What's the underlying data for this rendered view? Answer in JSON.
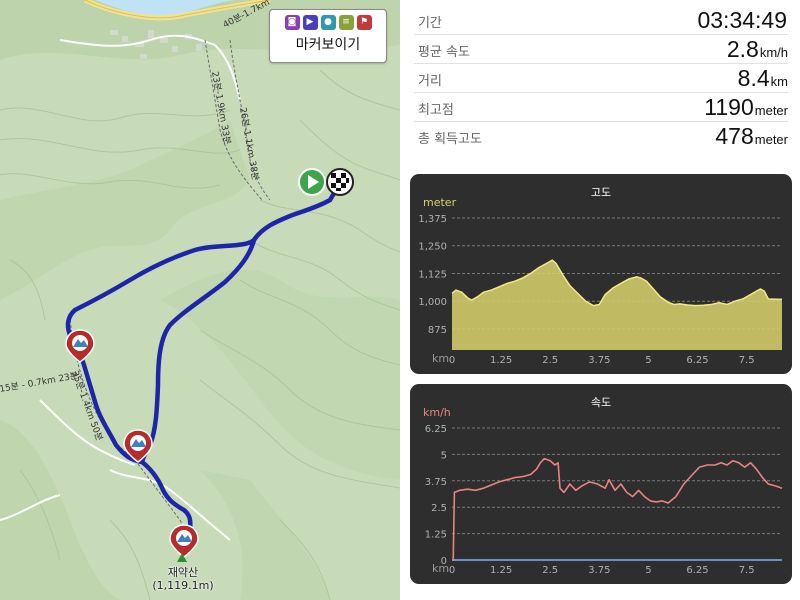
{
  "map": {
    "marker_toggle_label": "마커보이기",
    "marker_toggle_icons": [
      "camera-icon",
      "video-icon",
      "pin-icon",
      "note-icon",
      "flag-icon"
    ],
    "peak_name": "재약산",
    "peak_elevation": "(1,119.1m)",
    "trail_labels": [
      "40분-1.7km",
      "23분-1.9km 33분",
      "26분-1.1km 38분",
      "35분-1.4km 50분",
      "15분 - 0.7km 23분"
    ],
    "start_marker": "start-icon",
    "finish_marker": "finish-flag-icon",
    "route_color": "#1e25a8"
  },
  "stats": [
    {
      "label": "기간",
      "value": "03:34:49",
      "unit": ""
    },
    {
      "label": "평균 속도",
      "value": "2.8",
      "unit": "km/h"
    },
    {
      "label": "거리",
      "value": "8.4",
      "unit": "km"
    },
    {
      "label": "최고점",
      "value": "1190",
      "unit": "meter"
    },
    {
      "label": "총 획득고도",
      "value": "478",
      "unit": "meter"
    }
  ],
  "chart_data": [
    {
      "type": "area",
      "title": "고도",
      "ylabel": "meter",
      "xlabel": "km",
      "x_ticks": [
        0,
        1.25,
        2.5,
        3.75,
        5,
        6.25,
        7.5
      ],
      "y_ticks": [
        875,
        1000,
        1125,
        1250,
        1375
      ],
      "y_tick_labels": [
        "875",
        "1,000",
        "1,125",
        "1,250",
        "1,375"
      ],
      "ylim": [
        780,
        1375
      ],
      "xlim": [
        0,
        8.4
      ],
      "color": "#d9d36c",
      "x": [
        0,
        0.1,
        0.25,
        0.4,
        0.5,
        0.65,
        0.8,
        1.0,
        1.2,
        1.4,
        1.6,
        1.8,
        2.0,
        2.2,
        2.4,
        2.55,
        2.65,
        2.75,
        2.85,
        3.0,
        3.2,
        3.4,
        3.6,
        3.75,
        3.9,
        4.1,
        4.3,
        4.5,
        4.7,
        4.8,
        4.95,
        5.1,
        5.3,
        5.5,
        5.65,
        5.8,
        6.0,
        6.2,
        6.4,
        6.6,
        6.8,
        7.0,
        7.2,
        7.4,
        7.55,
        7.7,
        7.85,
        7.95,
        8.05,
        8.4
      ],
      "values": [
        1035,
        1050,
        1040,
        1015,
        1005,
        1020,
        1040,
        1050,
        1065,
        1080,
        1090,
        1105,
        1125,
        1150,
        1170,
        1185,
        1170,
        1140,
        1110,
        1070,
        1035,
        1000,
        980,
        985,
        1030,
        1060,
        1080,
        1100,
        1110,
        1105,
        1090,
        1060,
        1020,
        995,
        985,
        988,
        983,
        980,
        982,
        985,
        993,
        985,
        1000,
        1010,
        1025,
        1040,
        1055,
        1045,
        1010,
        1008
      ]
    },
    {
      "type": "line",
      "title": "속도",
      "ylabel": "km/h",
      "xlabel": "km",
      "x_ticks": [
        0,
        1.25,
        2.5,
        3.75,
        5,
        6.25,
        7.5
      ],
      "y_ticks": [
        0,
        1.25,
        2.5,
        3.75,
        5,
        6.25
      ],
      "y_tick_labels": [
        "0",
        "1.25",
        "2.5",
        "3.75",
        "5",
        "6.25"
      ],
      "ylim": [
        0,
        6.25
      ],
      "xlim": [
        0,
        8.4
      ],
      "color": "#e88484",
      "baseline_color": "#6f8cc8",
      "x": [
        0,
        0.03,
        0.06,
        0.2,
        0.4,
        0.6,
        0.8,
        1.0,
        1.2,
        1.4,
        1.6,
        1.8,
        2.0,
        2.15,
        2.25,
        2.35,
        2.5,
        2.62,
        2.7,
        2.75,
        2.85,
        3.0,
        3.15,
        3.3,
        3.5,
        3.7,
        3.9,
        4.0,
        4.15,
        4.3,
        4.45,
        4.6,
        4.75,
        4.9,
        5.05,
        5.2,
        5.35,
        5.5,
        5.7,
        5.9,
        6.1,
        6.3,
        6.5,
        6.7,
        6.85,
        7.0,
        7.15,
        7.3,
        7.45,
        7.6,
        7.75,
        7.9,
        8.05,
        8.25,
        8.4
      ],
      "values": [
        0,
        0,
        3.2,
        3.3,
        3.35,
        3.3,
        3.4,
        3.55,
        3.7,
        3.8,
        3.9,
        3.95,
        4.05,
        4.3,
        4.6,
        4.8,
        4.7,
        4.5,
        4.6,
        3.4,
        3.2,
        3.6,
        3.3,
        3.5,
        3.7,
        3.6,
        3.4,
        3.8,
        3.3,
        3.6,
        3.2,
        3.0,
        3.3,
        3.0,
        2.8,
        2.75,
        2.8,
        2.7,
        3.0,
        3.6,
        4.0,
        4.4,
        4.5,
        4.5,
        4.6,
        4.5,
        4.7,
        4.6,
        4.4,
        4.6,
        4.3,
        3.9,
        3.6,
        3.5,
        3.4
      ]
    }
  ]
}
